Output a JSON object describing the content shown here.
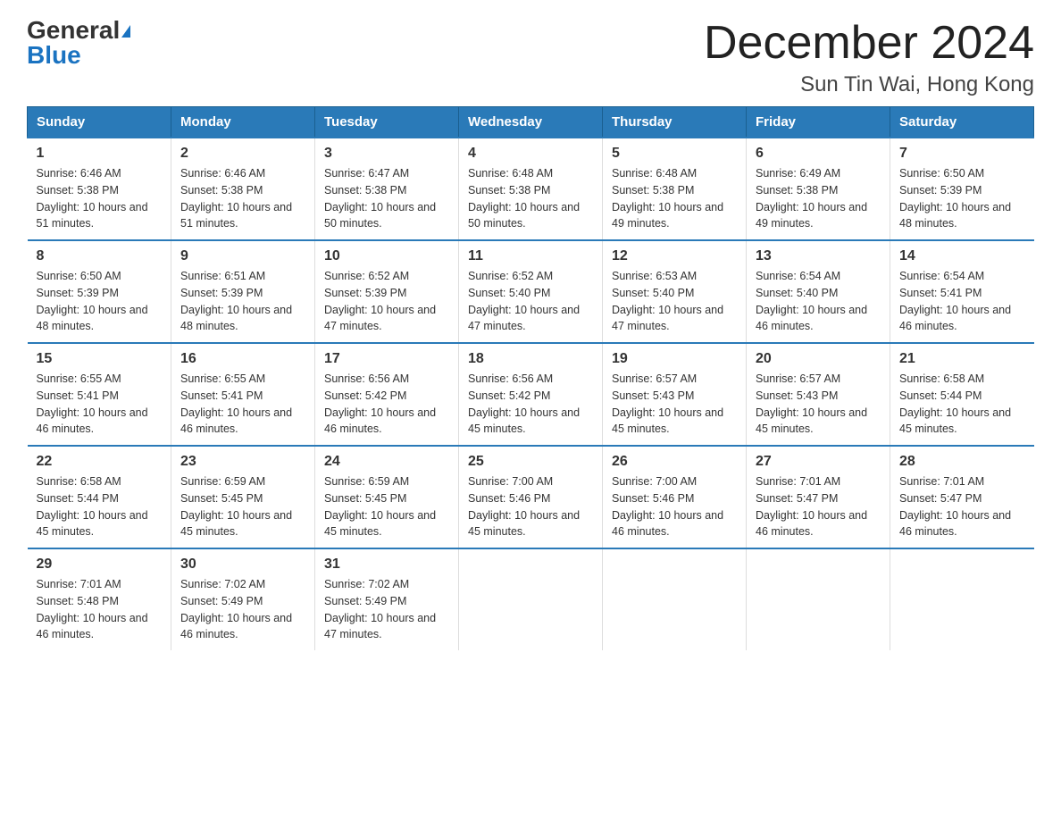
{
  "logo": {
    "general": "General",
    "blue": "Blue"
  },
  "title": "December 2024",
  "location": "Sun Tin Wai, Hong Kong",
  "header_days": [
    "Sunday",
    "Monday",
    "Tuesday",
    "Wednesday",
    "Thursday",
    "Friday",
    "Saturday"
  ],
  "weeks": [
    [
      {
        "day": "1",
        "sunrise": "6:46 AM",
        "sunset": "5:38 PM",
        "daylight": "10 hours and 51 minutes."
      },
      {
        "day": "2",
        "sunrise": "6:46 AM",
        "sunset": "5:38 PM",
        "daylight": "10 hours and 51 minutes."
      },
      {
        "day": "3",
        "sunrise": "6:47 AM",
        "sunset": "5:38 PM",
        "daylight": "10 hours and 50 minutes."
      },
      {
        "day": "4",
        "sunrise": "6:48 AM",
        "sunset": "5:38 PM",
        "daylight": "10 hours and 50 minutes."
      },
      {
        "day": "5",
        "sunrise": "6:48 AM",
        "sunset": "5:38 PM",
        "daylight": "10 hours and 49 minutes."
      },
      {
        "day": "6",
        "sunrise": "6:49 AM",
        "sunset": "5:38 PM",
        "daylight": "10 hours and 49 minutes."
      },
      {
        "day": "7",
        "sunrise": "6:50 AM",
        "sunset": "5:39 PM",
        "daylight": "10 hours and 48 minutes."
      }
    ],
    [
      {
        "day": "8",
        "sunrise": "6:50 AM",
        "sunset": "5:39 PM",
        "daylight": "10 hours and 48 minutes."
      },
      {
        "day": "9",
        "sunrise": "6:51 AM",
        "sunset": "5:39 PM",
        "daylight": "10 hours and 48 minutes."
      },
      {
        "day": "10",
        "sunrise": "6:52 AM",
        "sunset": "5:39 PM",
        "daylight": "10 hours and 47 minutes."
      },
      {
        "day": "11",
        "sunrise": "6:52 AM",
        "sunset": "5:40 PM",
        "daylight": "10 hours and 47 minutes."
      },
      {
        "day": "12",
        "sunrise": "6:53 AM",
        "sunset": "5:40 PM",
        "daylight": "10 hours and 47 minutes."
      },
      {
        "day": "13",
        "sunrise": "6:54 AM",
        "sunset": "5:40 PM",
        "daylight": "10 hours and 46 minutes."
      },
      {
        "day": "14",
        "sunrise": "6:54 AM",
        "sunset": "5:41 PM",
        "daylight": "10 hours and 46 minutes."
      }
    ],
    [
      {
        "day": "15",
        "sunrise": "6:55 AM",
        "sunset": "5:41 PM",
        "daylight": "10 hours and 46 minutes."
      },
      {
        "day": "16",
        "sunrise": "6:55 AM",
        "sunset": "5:41 PM",
        "daylight": "10 hours and 46 minutes."
      },
      {
        "day": "17",
        "sunrise": "6:56 AM",
        "sunset": "5:42 PM",
        "daylight": "10 hours and 46 minutes."
      },
      {
        "day": "18",
        "sunrise": "6:56 AM",
        "sunset": "5:42 PM",
        "daylight": "10 hours and 45 minutes."
      },
      {
        "day": "19",
        "sunrise": "6:57 AM",
        "sunset": "5:43 PM",
        "daylight": "10 hours and 45 minutes."
      },
      {
        "day": "20",
        "sunrise": "6:57 AM",
        "sunset": "5:43 PM",
        "daylight": "10 hours and 45 minutes."
      },
      {
        "day": "21",
        "sunrise": "6:58 AM",
        "sunset": "5:44 PM",
        "daylight": "10 hours and 45 minutes."
      }
    ],
    [
      {
        "day": "22",
        "sunrise": "6:58 AM",
        "sunset": "5:44 PM",
        "daylight": "10 hours and 45 minutes."
      },
      {
        "day": "23",
        "sunrise": "6:59 AM",
        "sunset": "5:45 PM",
        "daylight": "10 hours and 45 minutes."
      },
      {
        "day": "24",
        "sunrise": "6:59 AM",
        "sunset": "5:45 PM",
        "daylight": "10 hours and 45 minutes."
      },
      {
        "day": "25",
        "sunrise": "7:00 AM",
        "sunset": "5:46 PM",
        "daylight": "10 hours and 45 minutes."
      },
      {
        "day": "26",
        "sunrise": "7:00 AM",
        "sunset": "5:46 PM",
        "daylight": "10 hours and 46 minutes."
      },
      {
        "day": "27",
        "sunrise": "7:01 AM",
        "sunset": "5:47 PM",
        "daylight": "10 hours and 46 minutes."
      },
      {
        "day": "28",
        "sunrise": "7:01 AM",
        "sunset": "5:47 PM",
        "daylight": "10 hours and 46 minutes."
      }
    ],
    [
      {
        "day": "29",
        "sunrise": "7:01 AM",
        "sunset": "5:48 PM",
        "daylight": "10 hours and 46 minutes."
      },
      {
        "day": "30",
        "sunrise": "7:02 AM",
        "sunset": "5:49 PM",
        "daylight": "10 hours and 46 minutes."
      },
      {
        "day": "31",
        "sunrise": "7:02 AM",
        "sunset": "5:49 PM",
        "daylight": "10 hours and 47 minutes."
      },
      null,
      null,
      null,
      null
    ]
  ]
}
